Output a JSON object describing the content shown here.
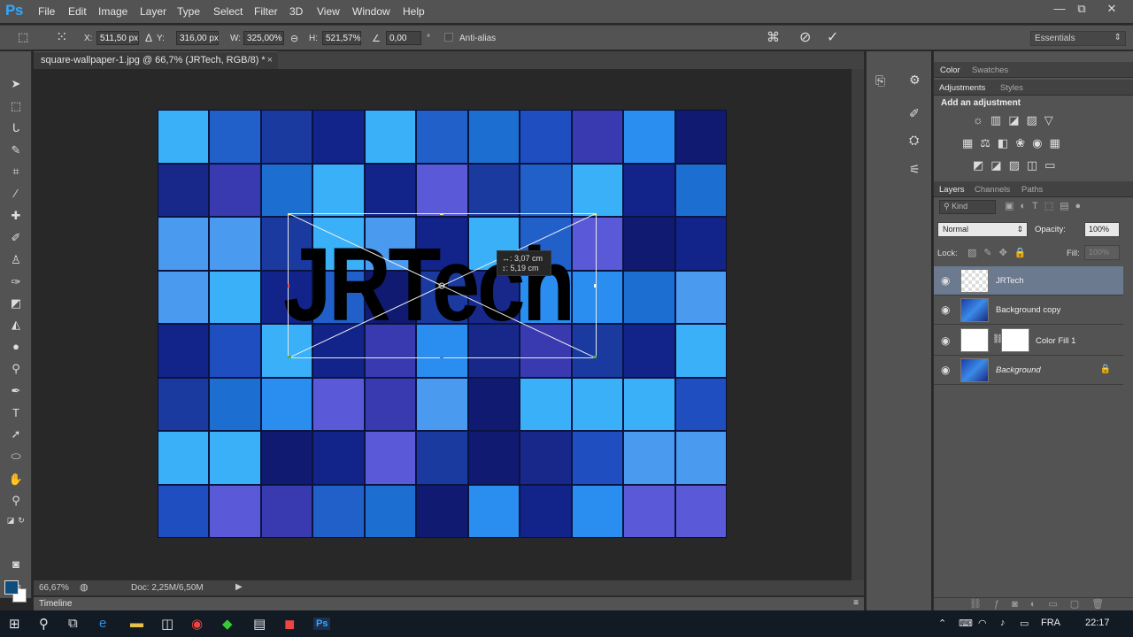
{
  "app": {
    "logo": "Ps",
    "menu": [
      "File",
      "Edit",
      "Image",
      "Layer",
      "Type",
      "Select",
      "Filter",
      "3D",
      "View",
      "Window",
      "Help"
    ]
  },
  "window_controls": {
    "minimize": "—",
    "restore": "⧉",
    "close": "✕"
  },
  "options": {
    "x_label": "X:",
    "x_value": "511,50 px",
    "y_label": "Y:",
    "y_value": "316,00 px",
    "w_label": "W:",
    "w_value": "325,00%",
    "h_label": "H:",
    "h_value": "521,57%",
    "angle_value": "0,00",
    "angle_unit": "°",
    "antialias_label": "Anti-alias",
    "workspace": "Essentials"
  },
  "document": {
    "tab_title": "square-wallpaper-1.jpg @ 66,7% (JRTech, RGB/8) *",
    "close": "×",
    "canvas_text": "JRTech"
  },
  "tooltip": {
    "line1": "↔: 3,07 cm",
    "line2": "↕: 5,19 cm"
  },
  "status": {
    "zoom": "66,67%",
    "doc": "Doc: 2,25M/6,50M"
  },
  "timeline_label": "Timeline",
  "panels": {
    "color_tabs": [
      "Color",
      "Swatches"
    ],
    "adjust_tabs": [
      "Adjustments",
      "Styles"
    ],
    "add_adjustment": "Add an adjustment",
    "layers_tabs": [
      "Layers",
      "Channels",
      "Paths"
    ],
    "kind_filter": "Kind",
    "blend_mode": "Normal",
    "opacity_label": "Opacity:",
    "opacity_value": "100%",
    "lock_label": "Lock:",
    "fill_label": "Fill:",
    "fill_value": "100%"
  },
  "layers": [
    {
      "name": "JRTech",
      "selected": true,
      "kind": "text"
    },
    {
      "name": "Background copy",
      "selected": false,
      "kind": "image"
    },
    {
      "name": "Color Fill 1",
      "selected": false,
      "kind": "fill"
    },
    {
      "name": "Background",
      "selected": false,
      "kind": "image",
      "locked": true
    }
  ],
  "taskbar": {
    "language": "FRA",
    "time": "22:17"
  },
  "colors": {
    "accent": "#31a8ff",
    "panel": "#535353",
    "canvas_bg": "#282828",
    "foreground": "#0e4e7c"
  }
}
